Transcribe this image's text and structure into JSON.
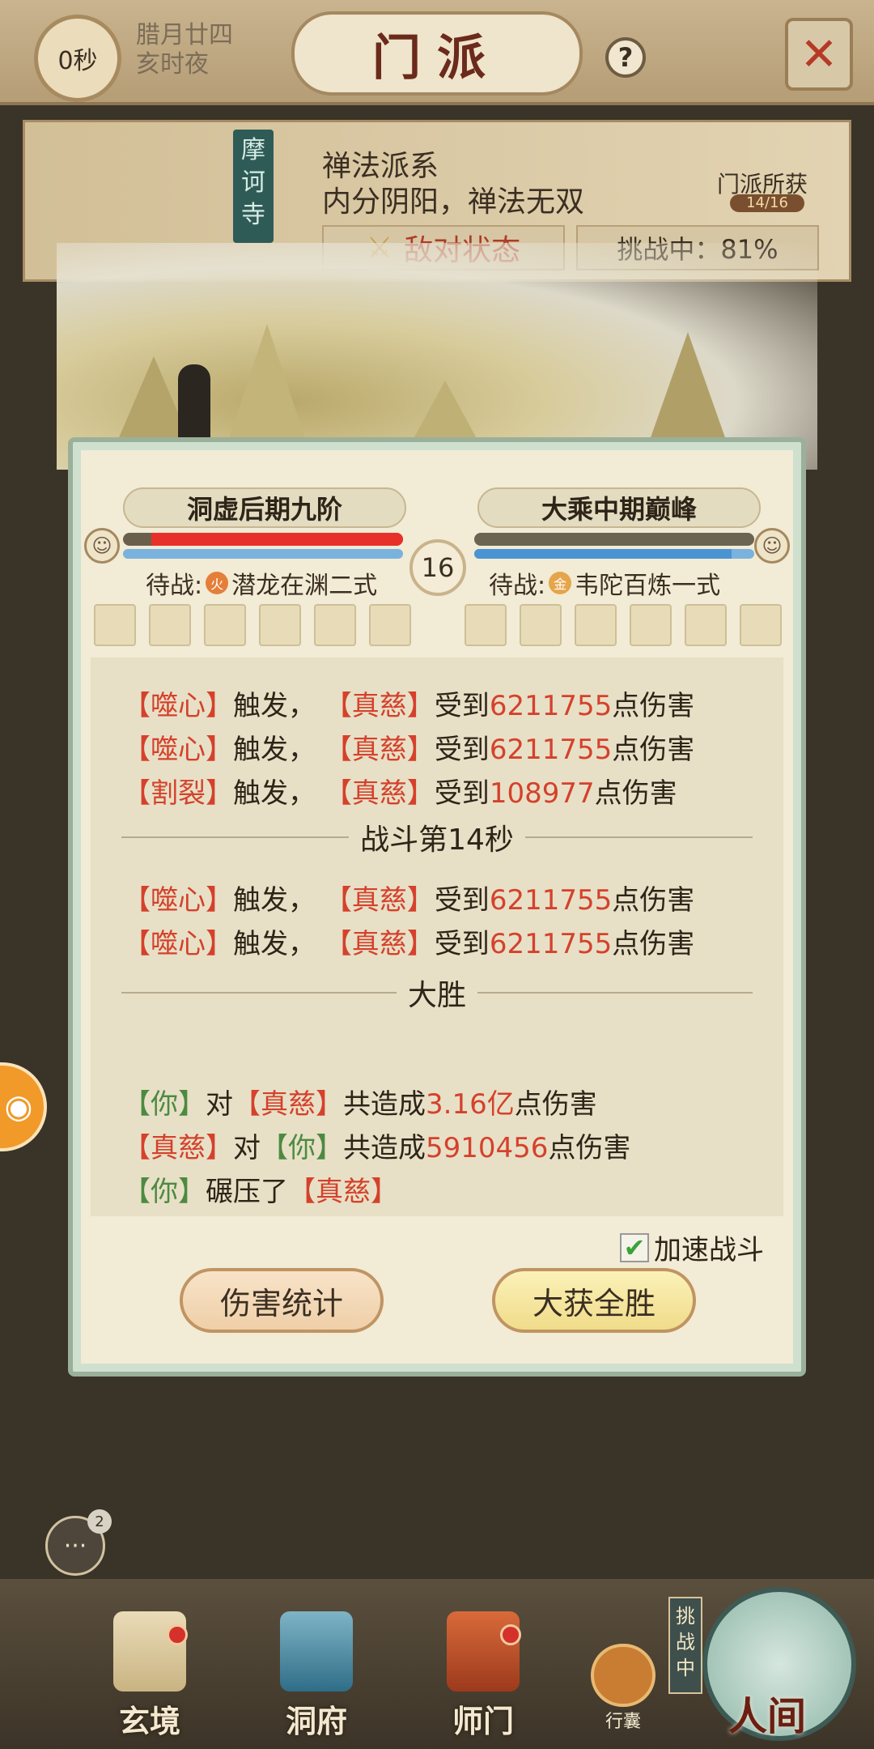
{
  "header": {
    "timer": "0秒",
    "lunar_date": "腊月廿四",
    "lunar_time": "亥时夜",
    "title": "门派",
    "help_label": "?",
    "close_label": "✕"
  },
  "sect": {
    "name": "摩诃寺",
    "line1": "禅法派系",
    "line2": "内分阴阳，禅法无双",
    "gains_label": "门派所获",
    "gains_count": "14/16",
    "hostile_label": "敌对状态",
    "challenge_label": "挑战中：81%"
  },
  "battle": {
    "left_realm": "洞虚后期九阶",
    "right_realm": "大乘中期巅峰",
    "round": "16",
    "left_hp_fraction": 0.9,
    "right_hp_fraction": 1.0,
    "right_mp_fraction": 0.92,
    "left_wait_label": "待战:",
    "left_wait_elem": "火",
    "left_wait_skill": "潜龙在渊二式",
    "right_wait_label": "待战:",
    "right_wait_elem": "金",
    "right_wait_skill": "韦陀百炼一式"
  },
  "log": {
    "rows": [
      {
        "a": "【噬心】",
        "b": "触发，",
        "c": "【真慈】",
        "d": "受到",
        "n": "6211755",
        "e": "点伤害"
      },
      {
        "a": "【噬心】",
        "b": "触发，",
        "c": "【真慈】",
        "d": "受到",
        "n": "6211755",
        "e": "点伤害"
      },
      {
        "a": "【割裂】",
        "b": "触发，",
        "c": "【真慈】",
        "d": "受到",
        "n": "108977",
        "e": "点伤害"
      }
    ],
    "divider_14": "战斗第14秒",
    "rows14": [
      {
        "a": "【噬心】",
        "b": "触发，",
        "c": "【真慈】",
        "d": "受到",
        "n": "6211755",
        "e": "点伤害"
      },
      {
        "a": "【噬心】",
        "b": "触发，",
        "c": "【真慈】",
        "d": "受到",
        "n": "6211755",
        "e": "点伤害"
      }
    ],
    "divider_win": "大胜",
    "summary": {
      "r1_a": "【你】",
      "r1_b": "对",
      "r1_c": "【真慈】",
      "r1_d": "共造成",
      "r1_n": "3.16亿",
      "r1_e": "点伤害",
      "r2_a": "【真慈】",
      "r2_b": "对",
      "r2_c": "【你】",
      "r2_d": "共造成",
      "r2_n": "5910456",
      "r2_e": "点伤害",
      "r3_a": "【你】",
      "r3_b": "碾压了",
      "r3_c": "【真慈】"
    }
  },
  "controls": {
    "speedup_label": "加速战斗",
    "speedup_checked": true,
    "damage_stats_label": "伤害统计",
    "victory_label": "大获全胜"
  },
  "chat": {
    "badge": "2"
  },
  "nav": {
    "items": [
      {
        "label": "玄境"
      },
      {
        "label": "洞府"
      },
      {
        "label": "师门"
      }
    ],
    "bag_label": "行囊",
    "challenge_tag": "挑战中",
    "world_label": "人间"
  },
  "colors": {
    "accent_red": "#d5412c",
    "accent_green": "#4d8a41",
    "check_green": "#3aa23c"
  }
}
